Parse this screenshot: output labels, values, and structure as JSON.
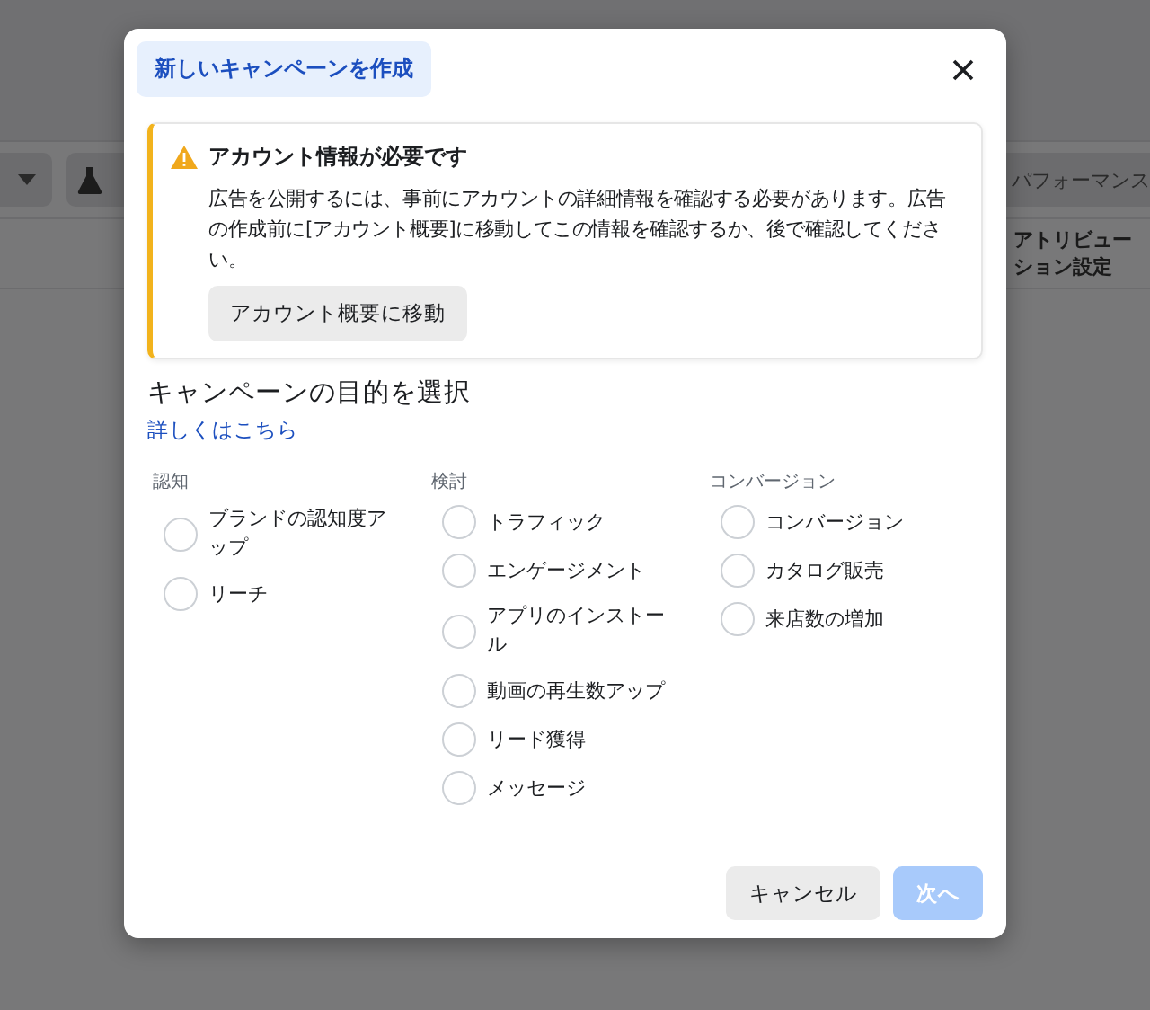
{
  "background": {
    "toolbar_right": "パフォーマンス",
    "column_header": "アトリビューション設定"
  },
  "dialog": {
    "title": "新しいキャンペーンを作成",
    "alert": {
      "heading": "アカウント情報が必要です",
      "body": "広告を公開するには、事前にアカウントの詳細情報を確認する必要があります。広告の作成前に[アカウント概要]に移動してこの情報を確認するか、後で確認してください。",
      "button": "アカウント概要に移動"
    },
    "section_title": "キャンペーンの目的を選択",
    "learn_more": "詳しくはこちら",
    "groups": [
      {
        "label": "認知",
        "options": [
          {
            "label": "ブランドの認知度アップ",
            "selected": false
          },
          {
            "label": "リーチ",
            "selected": false
          }
        ]
      },
      {
        "label": "検討",
        "options": [
          {
            "label": "トラフィック",
            "selected": false
          },
          {
            "label": "エンゲージメント",
            "selected": false
          },
          {
            "label": "アプリのインストール",
            "selected": false
          },
          {
            "label": "動画の再生数アップ",
            "selected": false
          },
          {
            "label": "リード獲得",
            "selected": false
          },
          {
            "label": "メッセージ",
            "selected": false
          }
        ]
      },
      {
        "label": "コンバージョン",
        "options": [
          {
            "label": "コンバージョン",
            "selected": false
          },
          {
            "label": "カタログ販売",
            "selected": false
          },
          {
            "label": "来店数の増加",
            "selected": false
          }
        ]
      }
    ],
    "buttons": [
      {
        "label": "キャンセル",
        "kind": "secondary",
        "disabled": false
      },
      {
        "label": "次へ",
        "kind": "primary",
        "disabled": true
      }
    ]
  }
}
